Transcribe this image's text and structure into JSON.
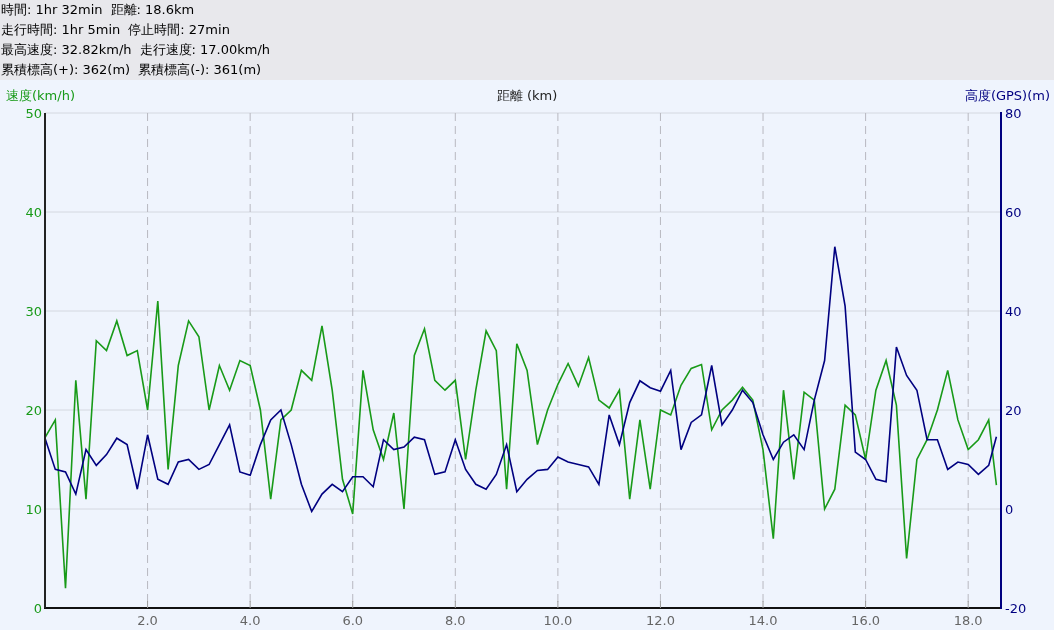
{
  "summary": {
    "lines": [
      [
        "時間: 1hr 32min",
        "距離: 18.6km"
      ],
      [
        "走行時間: 1hr 5min",
        "停止時間: 27min"
      ],
      [
        "最高速度: 32.82km/h",
        "走行速度: 17.00km/h"
      ],
      [
        "累積標高(+): 362(m)",
        "累積標高(-): 361(m)"
      ]
    ]
  },
  "chart_data": {
    "type": "line",
    "grid": true,
    "xlabel": "距離 (km)",
    "xlim": [
      0,
      18.64
    ],
    "xticks": [
      {
        "value": 2,
        "label": "2.0"
      },
      {
        "value": 4,
        "label": "4.0"
      },
      {
        "value": 6,
        "label": "6.0"
      },
      {
        "value": 8,
        "label": "8.0"
      },
      {
        "value": 10,
        "label": "10.0"
      },
      {
        "value": 12,
        "label": "12.0"
      },
      {
        "value": 14,
        "label": "14.0"
      },
      {
        "value": 16,
        "label": "16.0"
      },
      {
        "value": 18,
        "label": "18.0"
      }
    ],
    "ylim": [
      0,
      50
    ],
    "yticks": [
      0,
      10,
      20,
      30,
      40,
      50
    ],
    "y2lim": [
      -20,
      80
    ],
    "y2ticks": [
      -20,
      0,
      20,
      40,
      60,
      80
    ],
    "x": [
      0,
      0.2,
      0.4,
      0.6,
      0.8,
      1,
      1.2,
      1.4,
      1.6,
      1.8,
      2,
      2.2,
      2.4,
      2.6,
      2.8,
      3,
      3.2,
      3.4,
      3.6,
      3.8,
      4,
      4.2,
      4.4,
      4.6,
      4.8,
      5,
      5.2,
      5.4,
      5.6,
      5.8,
      6,
      6.2,
      6.4,
      6.6,
      6.8,
      7,
      7.2,
      7.4,
      7.6,
      7.8,
      8,
      8.2,
      8.4,
      8.6,
      8.8,
      9,
      9.2,
      9.4,
      9.6,
      9.8,
      10,
      10.2,
      10.4,
      10.6,
      10.8,
      11,
      11.2,
      11.4,
      11.6,
      11.8,
      12,
      12.2,
      12.4,
      12.6,
      12.8,
      13,
      13.2,
      13.4,
      13.6,
      13.8,
      14,
      14.2,
      14.4,
      14.6,
      14.8,
      15,
      15.2,
      15.4,
      15.6,
      15.8,
      16,
      16.2,
      16.4,
      16.6,
      16.8,
      17,
      17.2,
      17.4,
      17.6,
      17.8,
      18,
      18.2,
      18.4,
      18.55
    ],
    "series": [
      {
        "name": "速度(km/h)",
        "color": "#189a18",
        "values": [
          17.2,
          19,
          2,
          23,
          11,
          27,
          26,
          29,
          25.5,
          26,
          20,
          31,
          14,
          24.5,
          29,
          27.4,
          20,
          24.5,
          22,
          25,
          24.5,
          20,
          11,
          19,
          20,
          24,
          23,
          28.5,
          22,
          13,
          9.5,
          24,
          18,
          15,
          19.7,
          10,
          25.5,
          28.2,
          23,
          22,
          23,
          15,
          22,
          28,
          26,
          12,
          26.7,
          24,
          16.5,
          20,
          22.6,
          24.7,
          22.4,
          25.3,
          21,
          20.2,
          22,
          11,
          19,
          12,
          20,
          19.5,
          22.5,
          24.2,
          24.6,
          18,
          20,
          21,
          22.3,
          21,
          16,
          7,
          22,
          13,
          21.8,
          21,
          10,
          12,
          20.5,
          19.5,
          15,
          22,
          25,
          20.5,
          5,
          15,
          17,
          20,
          24,
          19,
          16,
          17,
          19,
          12.4
        ]
      },
      {
        "name": "高度(GPS)(m)",
        "axis": "y2",
        "color": "#000080",
        "values": [
          14.3,
          8,
          7.5,
          3,
          12,
          8.8,
          11,
          14.3,
          13,
          4,
          15,
          6,
          5,
          9.5,
          10,
          8,
          9,
          13,
          17,
          7.5,
          6.8,
          13,
          18,
          20,
          13,
          5,
          -0.5,
          3,
          5,
          3.5,
          6.5,
          6.5,
          4.5,
          14,
          12,
          12.5,
          14.5,
          14,
          7,
          7.5,
          14,
          8,
          5,
          4,
          7,
          13,
          3.5,
          6,
          7.8,
          8,
          10.5,
          9.5,
          9,
          8.5,
          5,
          19,
          13,
          21.5,
          25.9,
          24.5,
          23.8,
          28,
          12,
          17.5,
          19,
          29,
          17,
          20,
          24,
          21.5,
          15,
          10,
          13.5,
          15,
          12,
          22,
          30,
          53,
          41,
          11.5,
          10,
          6,
          5.5,
          32.7,
          27,
          24,
          14,
          14,
          8,
          9.5,
          9,
          7,
          8.8,
          14.6
        ]
      }
    ]
  }
}
